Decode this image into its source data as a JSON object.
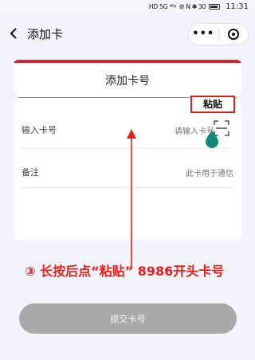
{
  "status_bar": {
    "network_icons": "HD 5G ⁴⁶ᵍ",
    "right_icons": "⚙ N ✱ 30",
    "time": "11:31"
  },
  "header": {
    "title": "添加卡",
    "more_label": "•••"
  },
  "card": {
    "title": "添加卡号",
    "paste_label": "粘贴",
    "rows": [
      {
        "label": "输入卡号",
        "placeholder": "请输入卡号"
      },
      {
        "label": "备注",
        "placeholder": "此卡用于通信"
      }
    ]
  },
  "instruction": "③ 长按后点“粘贴” 8986开头卡号",
  "submit_label": "提交卡号",
  "colors": {
    "accent_red": "#d6242c",
    "annotation_red": "#e5201a",
    "marker_teal": "#13887a",
    "disabled_button": "#a9a9a9"
  }
}
